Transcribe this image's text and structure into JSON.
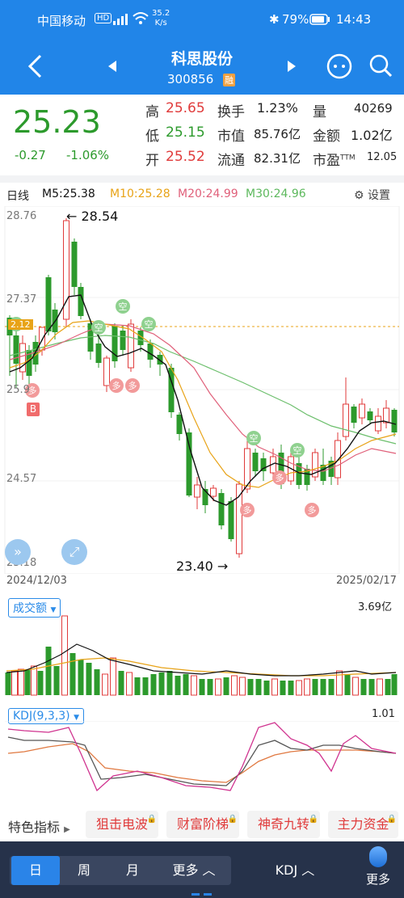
{
  "status": {
    "carrier": "中国移动",
    "network_badge": "HD",
    "net_speed": "35.2",
    "net_unit": "K/s",
    "battery": "79%",
    "time": "14:43"
  },
  "header": {
    "title": "科思股份",
    "code": "300856",
    "badge": "融"
  },
  "quote": {
    "price": "25.23",
    "change": "-0.27",
    "change_pct": "-1.06%",
    "high_label": "高",
    "high": "25.65",
    "low_label": "低",
    "low": "25.15",
    "open_label": "开",
    "open": "25.52",
    "turnover_label": "换手",
    "turnover": "1.23%",
    "mktcap_label": "市值",
    "mktcap": "85.76亿",
    "float_label": "流通",
    "float": "82.31亿",
    "volume_label": "量",
    "volume": "40269",
    "amount_label": "金额",
    "amount": "1.02亿",
    "pe_label": "市盈",
    "pe_sup": "TTM",
    "pe": "12.05"
  },
  "ma_bar": {
    "period": "日线",
    "ma5": "M5:25.38",
    "ma10": "M10:25.28",
    "ma20": "M20:24.99",
    "ma30": "M30:24.96",
    "settings": "设置"
  },
  "chart": {
    "y_top": "28.76",
    "y_2": "27.37",
    "y_3": "25.9",
    "y_4": "24.57",
    "y_bottom": "23.18",
    "high_note": "28.54",
    "low_note": "23.40",
    "date_start": "2024/12/03",
    "date_end": "2025/02/17",
    "price_tag": "2.12",
    "b_marker": "B",
    "sell_marker": "空",
    "buy_marker": "多"
  },
  "volume_panel": {
    "label": "成交额",
    "max": "3.69亿"
  },
  "kdj_panel": {
    "label": "KDJ(9,3,3)",
    "max": "1.01"
  },
  "features": {
    "label": "特色指标",
    "items": [
      "狙击电波",
      "财富阶梯",
      "神奇九转",
      "主力资金"
    ]
  },
  "bottom_tabs": {
    "day": "日",
    "week": "周",
    "month": "月",
    "more_period": "更多",
    "indicator": "KDJ",
    "more": "更多"
  },
  "colors": {
    "up": "#e03b3b",
    "down": "#2c9a2c",
    "ma5": "#111111",
    "ma10": "#e8a317",
    "ma20": "#e0607a",
    "ma30": "#6cbf6c",
    "brand": "#2185e8"
  }
}
